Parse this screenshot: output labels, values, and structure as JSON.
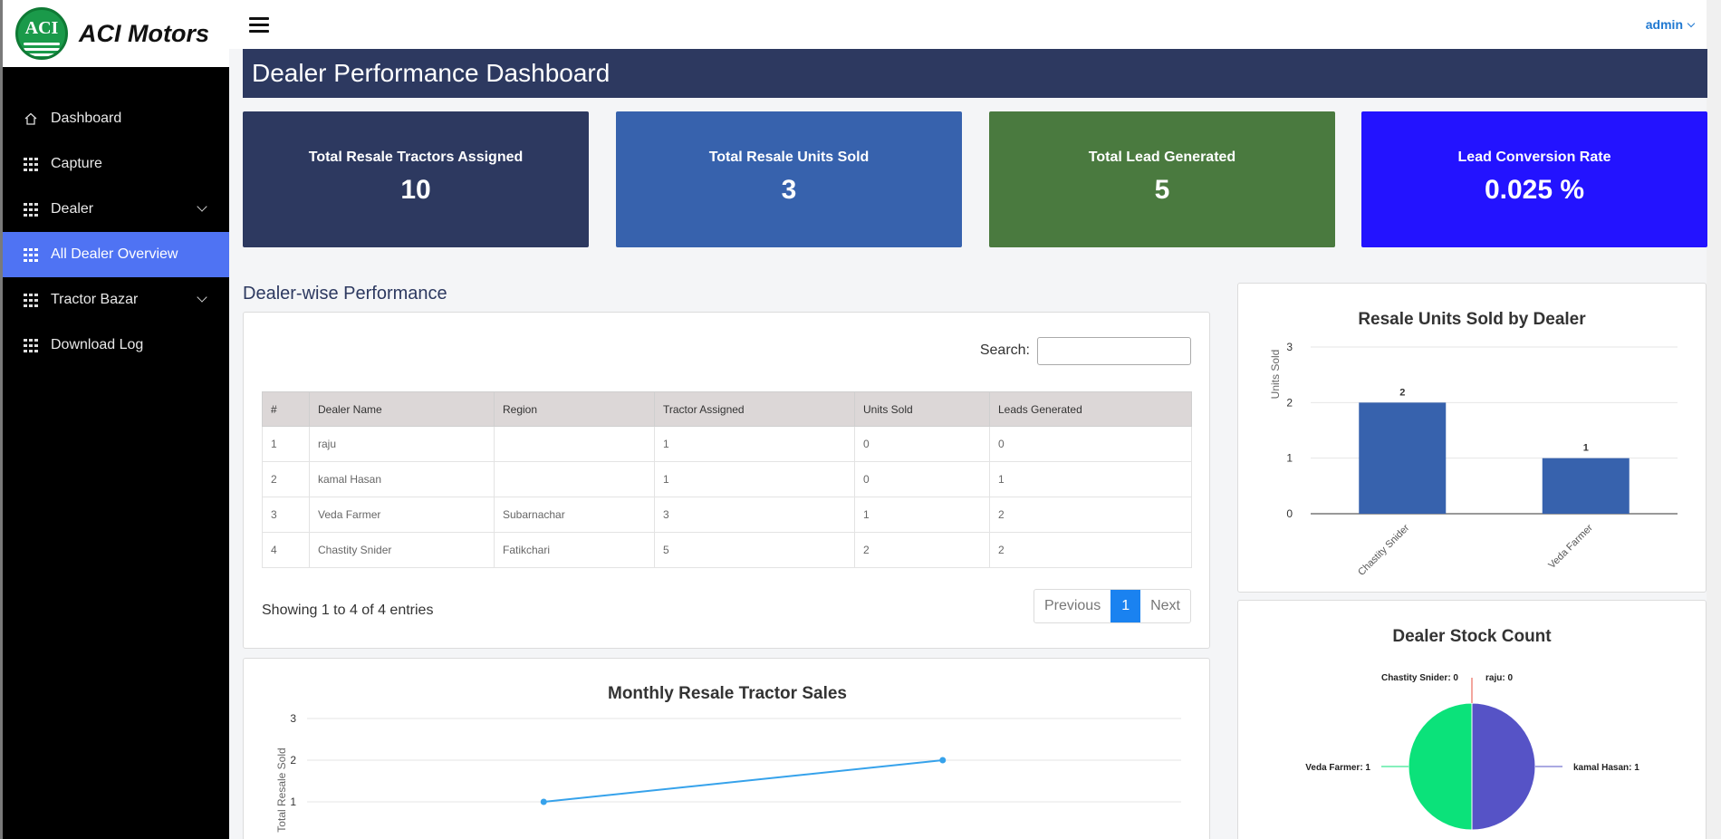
{
  "brand": {
    "logo_text": "ACI",
    "name": "ACI Motors"
  },
  "sidebar": {
    "items": [
      {
        "label": "Dashboard",
        "icon": "home-icon",
        "active": false,
        "chevron": false
      },
      {
        "label": "Capture",
        "icon": "grid-icon",
        "active": false,
        "chevron": false
      },
      {
        "label": "Dealer",
        "icon": "grid-icon",
        "active": false,
        "chevron": true
      },
      {
        "label": "All Dealer Overview",
        "icon": "grid-icon",
        "active": true,
        "chevron": false
      },
      {
        "label": "Tractor Bazar",
        "icon": "grid-icon",
        "active": false,
        "chevron": true
      },
      {
        "label": "Download Log",
        "icon": "grid-icon",
        "active": false,
        "chevron": false
      }
    ]
  },
  "topbar": {
    "user": "admin"
  },
  "page": {
    "title": "Dealer Performance Dashboard"
  },
  "cards": [
    {
      "label": "Total Resale Tractors Assigned",
      "value": "10",
      "color": "#2d3960"
    },
    {
      "label": "Total Resale Units Sold",
      "value": "3",
      "color": "#3762ad"
    },
    {
      "label": "Total Lead Generated",
      "value": "5",
      "color": "#4a7a3f"
    },
    {
      "label": "Lead Conversion Rate",
      "value": "0.025 %",
      "color": "#2313ff"
    }
  ],
  "dealer_section": {
    "title": "Dealer-wise Performance",
    "search_label": "Search:",
    "columns": [
      "#",
      "Dealer Name",
      "Region",
      "Tractor Assigned",
      "Units Sold",
      "Leads Generated"
    ],
    "rows": [
      [
        "1",
        "raju",
        "",
        "1",
        "0",
        "0"
      ],
      [
        "2",
        "kamal Hasan",
        "",
        "1",
        "0",
        "1"
      ],
      [
        "3",
        "Veda Farmer",
        "Subarnachar",
        "3",
        "1",
        "2"
      ],
      [
        "4",
        "Chastity Snider",
        "Fatikchari",
        "5",
        "2",
        "2"
      ]
    ],
    "showing": "Showing 1 to 4 of 4 entries",
    "pagination": {
      "previous": "Previous",
      "current": "1",
      "next": "Next"
    }
  },
  "chart_data": [
    {
      "type": "bar",
      "title": "Resale Units Sold by Dealer",
      "ylabel": "Units Sold",
      "xlabel": "",
      "categories": [
        "Chastity Snider",
        "Veda Farmer"
      ],
      "values": [
        2,
        1
      ],
      "ylim": [
        0,
        3
      ],
      "yticks": [
        0,
        1,
        2,
        3
      ],
      "color": "#3762ad",
      "grid": true
    },
    {
      "type": "line",
      "title": "Monthly Resale Tractor Sales",
      "ylabel": "Total Resale Sold",
      "xlabel": "",
      "points": [
        1,
        2
      ],
      "ylim": [
        0,
        3
      ],
      "yticks": [
        1,
        2,
        3
      ],
      "color": "#36a2eb",
      "grid": true
    },
    {
      "type": "pie",
      "title": "Dealer Stock Count",
      "slices": [
        {
          "label": "Chastity Snider: 0",
          "value": 0,
          "color": "#e74c3c"
        },
        {
          "label": "raju: 0",
          "value": 0,
          "color": "#e74c3c"
        },
        {
          "label": "kamal Hasan: 1",
          "value": 1,
          "color": "#5653c6"
        },
        {
          "label": "Veda Farmer: 1",
          "value": 1,
          "color": "#0be27a"
        }
      ]
    }
  ]
}
